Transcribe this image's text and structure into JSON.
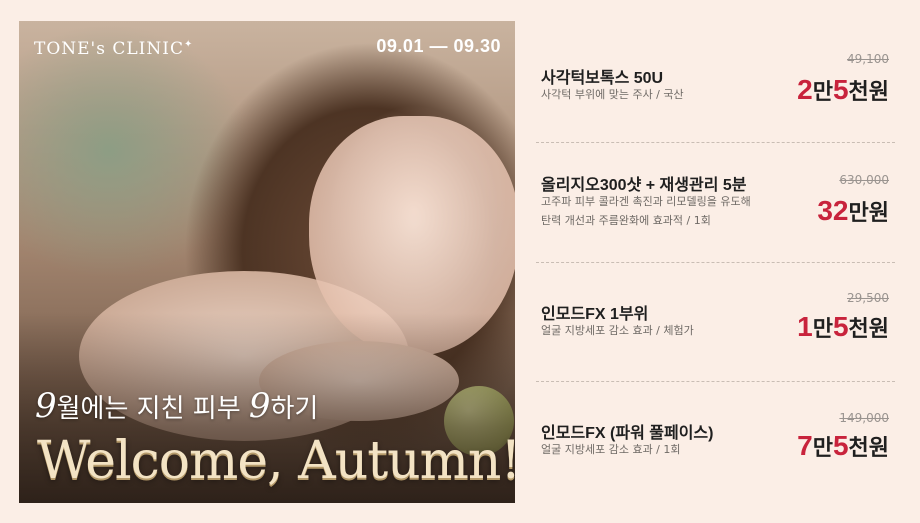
{
  "hero": {
    "brand": "TONE's CLINIC",
    "brand_star": "✦",
    "dates": "09.01 — 09.30",
    "tagline_9a": "9",
    "tagline_mid": "월에는 지친 피부 ",
    "tagline_9b": "9",
    "tagline_end": "하기",
    "welcome": "Welcome, Autumn!"
  },
  "items": [
    {
      "name": "사각턱보톡스 50U",
      "desc": [
        "사각턱 부위에 맞는 주사 / 국산"
      ],
      "old_price": "49,100",
      "price_parts": [
        [
          "2",
          "red"
        ],
        [
          "만",
          ""
        ],
        [
          "5",
          "red"
        ],
        [
          "천원",
          ""
        ]
      ]
    },
    {
      "name": "올리지오300샷 + 재생관리 5분",
      "desc": [
        "고주파 피부 콜라겐 촉진과 리모델링을 유도해",
        "탄력 개선과 주름완화에 효과적 / 1회"
      ],
      "old_price": "630,000",
      "price_parts": [
        [
          "32",
          "red"
        ],
        [
          "만원",
          ""
        ]
      ]
    },
    {
      "name": "인모드FX 1부위",
      "desc": [
        "얼굴 지방세포 감소 효과 / 체험가"
      ],
      "old_price": "29,500",
      "price_parts": [
        [
          "1",
          "red"
        ],
        [
          "만",
          ""
        ],
        [
          "5",
          "red"
        ],
        [
          "천원",
          ""
        ]
      ]
    },
    {
      "name": "인모드FX (파워 풀페이스)",
      "desc": [
        "얼굴 지방세포 감소 효과 / 1회"
      ],
      "old_price": "149,000",
      "price_parts": [
        [
          "7",
          "red"
        ],
        [
          "만",
          ""
        ],
        [
          "5",
          "red"
        ],
        [
          "천원",
          ""
        ]
      ]
    }
  ],
  "colors": {
    "accent": "#c8233c",
    "background": "#fbeee6"
  }
}
